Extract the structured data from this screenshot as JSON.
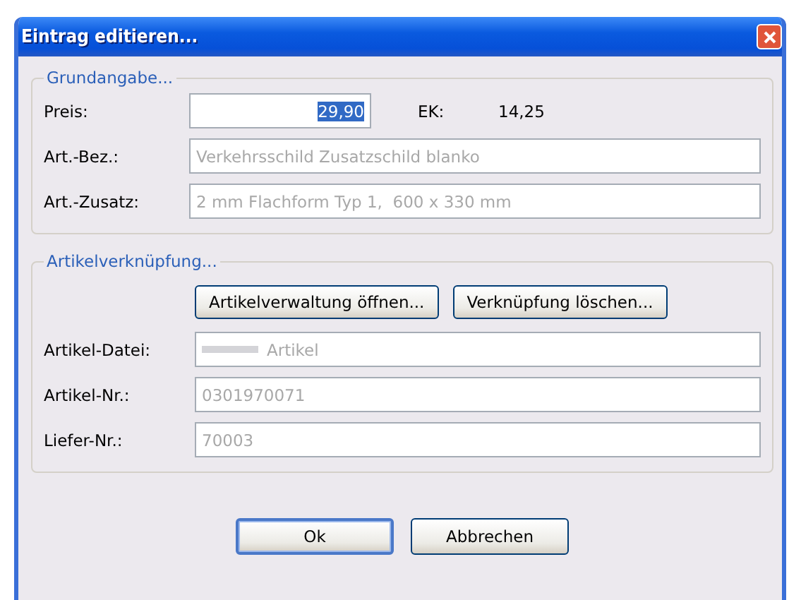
{
  "window": {
    "title": "Eintrag editieren..."
  },
  "groups": [
    {
      "legend": "Grundangabe...",
      "fields": [
        {
          "kind": "price",
          "label": "Preis:",
          "value": "29,90",
          "disabled": false,
          "selected": true,
          "extra_label": "EK:",
          "extra_value": "14,25"
        },
        {
          "kind": "text",
          "label": "Art.-Bez.:",
          "value": "Verkehrsschild Zusatzschild blanko",
          "disabled": true,
          "selected": false
        },
        {
          "kind": "text",
          "label": "Art.-Zusatz:",
          "value": "2 mm Flachform Typ 1,  600 x 330 mm",
          "disabled": true,
          "selected": false
        }
      ]
    },
    {
      "legend": "Artikelverknüpfung...",
      "buttons": [
        "Artikelverwaltung öffnen...",
        "Verknüpfung löschen..."
      ],
      "fields": [
        {
          "kind": "text",
          "label": "Artikel-Datei:",
          "value": "Artikel",
          "redacted_prefix": true,
          "disabled": true,
          "selected": false
        },
        {
          "kind": "text",
          "label": "Artikel-Nr.:",
          "value": "0301970071",
          "disabled": true,
          "selected": false
        },
        {
          "kind": "text",
          "label": "Liefer-Nr.:",
          "value": "70003",
          "disabled": true,
          "selected": false
        }
      ]
    }
  ],
  "buttons": [
    {
      "label": "Ok",
      "default": true
    },
    {
      "label": "Abbrechen",
      "default": false
    }
  ]
}
